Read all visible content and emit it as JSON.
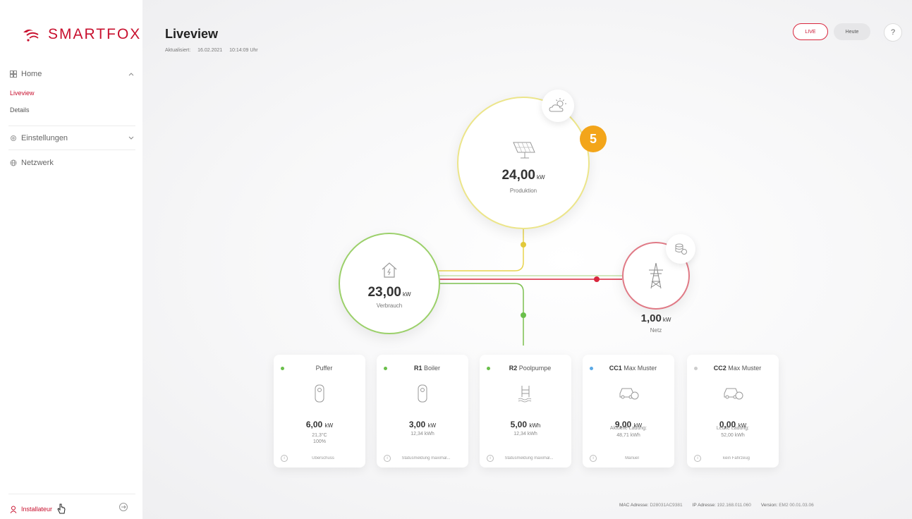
{
  "app": {
    "logo": "SMARTFOX"
  },
  "sidebar": {
    "home": "Home",
    "liveview": "Liveview",
    "details": "Details",
    "einstellungen": "Einstellungen",
    "netzwerk": "Netzwerk",
    "installateur": "Installateur"
  },
  "header": {
    "title": "Liveview",
    "updated_label": "Aktualisiert:",
    "updated_date": "16.02.2021",
    "updated_time": "10:14:09 Uhr",
    "live_button": "LIVE",
    "heute_button": "Heute",
    "help_button": "?"
  },
  "step_badge": "5",
  "flow": {
    "produktion": {
      "value": "24,00",
      "unit": "kW",
      "label": "Produktion"
    },
    "verbrauch": {
      "value": "23,00",
      "unit": "kW",
      "label": "Verbrauch"
    },
    "netz": {
      "value": "1,00",
      "unit": "kW",
      "label": "Netz"
    }
  },
  "cards": [
    {
      "prefix": "",
      "name": "Puffer",
      "value": "6,00",
      "unit": "kW",
      "sub1": "21,3°C",
      "sub2": "100%",
      "foot": "Überschuss",
      "dot": "#6abf4b"
    },
    {
      "prefix": "R1",
      "name": "Boiler",
      "value": "3,00",
      "unit": "kW",
      "sub1": "12,34 kWh",
      "sub2": "",
      "foot": "Statusmeldung maximal...",
      "dot": "#6abf4b"
    },
    {
      "prefix": "R2",
      "name": "Poolpumpe",
      "value": "5,00",
      "unit": "kWh",
      "sub1": "12,34 kWh",
      "sub2": "",
      "foot": "Statusmeldung maximal...",
      "dot": "#6abf4b"
    },
    {
      "prefix": "CC1",
      "name": "Max Muster",
      "value": "9,00",
      "unit": "kW",
      "sub1": "Aktuelle Ladung:",
      "sub2": "48,71 kWh",
      "foot": "Manuel",
      "dot": "#5aa9e6"
    },
    {
      "prefix": "CC2",
      "name": "Max Muster",
      "value": "0,00",
      "unit": "kW",
      "sub1": "Letzte Ladung:",
      "sub2": "52,00 kWh",
      "foot": "kein Fahrzeug",
      "dot": "#cccccc"
    }
  ],
  "status": {
    "mac_label": "MAC Adresse:",
    "mac": "D28031AC9381",
    "ip_label": "IP Adresse:",
    "ip": "192.168.011.060",
    "version_label": "Version:",
    "version": "EM2 00.01.03.06"
  },
  "colors": {
    "brand": "#c8102e",
    "production": "#e8d44d",
    "consumption": "#7cc04f",
    "grid": "#d9263d",
    "badge": "#f3a51a"
  }
}
